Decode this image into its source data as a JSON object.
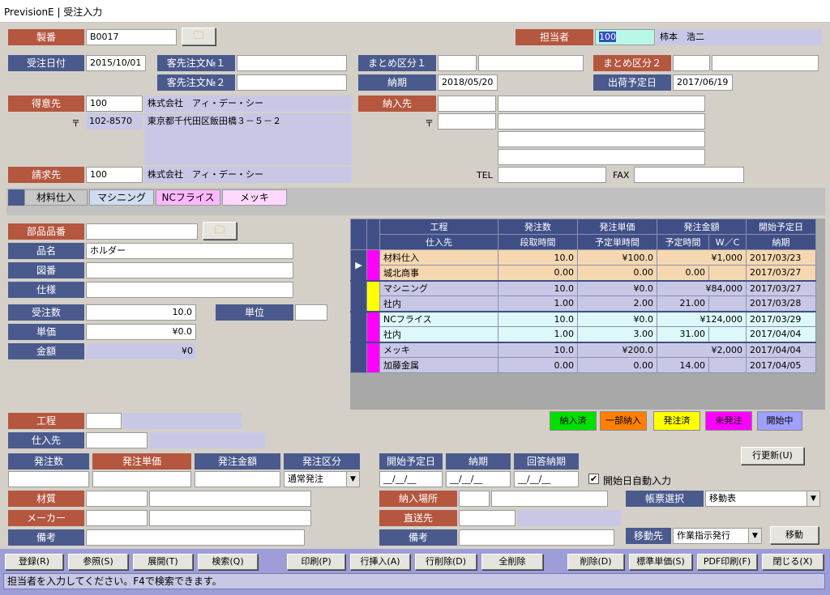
{
  "window": {
    "title": "PrevisionE | 受注入力"
  },
  "header": {
    "seiban_label": "製番",
    "seiban_value": "B0017",
    "tantou_label": "担当者",
    "tantou_code": "100",
    "tantou_name": "柿本　浩二",
    "juchubi_label": "受注日付",
    "juchubi_value": "2015/10/01",
    "kyakusaki1_label": "客先注文№１",
    "kyakusaki1_value": "",
    "kyakusaki2_label": "客先注文№２",
    "kyakusaki2_value": "",
    "matome1_label": "まとめ区分１",
    "matome1_a": "",
    "matome1_b": "",
    "matome2_label": "まとめ区分２",
    "matome2_a": "",
    "matome2_b": "",
    "nouki_label": "納期",
    "nouki_value": "2018/05/20",
    "shukka_label": "出荷予定日",
    "shukka_value": "2017/06/19",
    "tokuisaki_label": "得意先",
    "tokuisaki_code": "100",
    "tokuisaki_name": "株式会社　アィ・デー・シー",
    "zip_mark": "〒",
    "zip_value": "102-8570",
    "address": "東京都千代田区飯田橋３－５－２",
    "seikyusaki_label": "請求先",
    "seikyusaki_code": "100",
    "seikyusaki_name": "株式会社　アィ・デー・シー",
    "nounyusaki_label": "納入先",
    "nounyusaki_zip_mark": "〒",
    "tel_label": "TEL",
    "fax_label": "FAX"
  },
  "tabs": [
    {
      "label": "材料仕入",
      "color": "#c8c8c8"
    },
    {
      "label": "マシニング",
      "color": "#d0dcf0"
    },
    {
      "label": "NCフライス",
      "color": "#ffb8ff"
    },
    {
      "label": "メッキ",
      "color": "#ffd8ff"
    }
  ],
  "part": {
    "buhin_label": "部品品番",
    "buhin_value": "",
    "hinmei_label": "品名",
    "hinmei_value": "ホルダー",
    "zuban_label": "図番",
    "zuban_value": "",
    "shiyou_label": "仕様",
    "shiyou_value": "",
    "juchusu_label": "受注数",
    "juchusu_value": "10.0",
    "tani_label": "単位",
    "tani_value": "",
    "tanka_label": "単価",
    "tanka_value": "¥0.0",
    "kingaku_label": "金額",
    "kingaku_value": "¥0"
  },
  "grid": {
    "header1": [
      "工程",
      "発注数",
      "発注単価",
      "発注金額",
      "開始予定日"
    ],
    "header2": [
      "仕入先",
      "段取時間",
      "予定単時間",
      "予定時間",
      "W／C",
      "納期"
    ],
    "rows": [
      {
        "color": "#ff00ff",
        "bg": "#f5d8b0",
        "selected": true,
        "koutei": "材料仕入",
        "hatchusu": "10.0",
        "tanka": "¥100.0",
        "kingaku": "¥1,000",
        "kaishi": "2017/03/23",
        "shiire": "城北商事",
        "dandori": "0.00",
        "tanjikan": "0.00",
        "yotei": "0.00",
        "wc": "",
        "nouki": "2017/03/27"
      },
      {
        "color": "#ffff00",
        "bg": "#c8c8e6",
        "selected": false,
        "koutei": "マシニング",
        "hatchusu": "10.0",
        "tanka": "¥0.0",
        "kingaku": "¥84,000",
        "kaishi": "2017/03/27",
        "shiire": "社内",
        "dandori": "1.00",
        "tanjikan": "2.00",
        "yotei": "21.00",
        "wc": "",
        "nouki": "2017/03/28"
      },
      {
        "color": "#ff00ff",
        "bg": "#dcf8f8",
        "selected": false,
        "koutei": "NCフライス",
        "hatchusu": "10.0",
        "tanka": "¥0.0",
        "kingaku": "¥124,000",
        "kaishi": "2017/03/29",
        "shiire": "社内",
        "dandori": "1.00",
        "tanjikan": "3.00",
        "yotei": "31.00",
        "wc": "",
        "nouki": "2017/04/04"
      },
      {
        "color": "#ff00ff",
        "bg": "#c8c8e6",
        "selected": false,
        "koutei": "メッキ",
        "hatchusu": "10.0",
        "tanka": "¥200.0",
        "kingaku": "¥2,000",
        "kaishi": "2017/04/04",
        "shiire": "加藤金属",
        "dandori": "0.00",
        "tanjikan": "0.00",
        "yotei": "14.00",
        "wc": "",
        "nouki": "2017/04/05"
      }
    ]
  },
  "legend": [
    {
      "label": "納入済",
      "color": "#00e000"
    },
    {
      "label": "一部納入",
      "color": "#ff8000"
    },
    {
      "label": "発注済",
      "color": "#ffff00"
    },
    {
      "label": "未発注",
      "color": "#ff00ff"
    },
    {
      "label": "開始中",
      "color": "#a0a0ff"
    }
  ],
  "detail": {
    "koutei_label": "工程",
    "shiiresaki_label": "仕入先",
    "hatchusu_label": "発注数",
    "hatchutanka_label": "発注単価",
    "hatchukingaku_label": "発注金額",
    "hatchukubun_label": "発注区分",
    "hatchukubun_value": "通常発注",
    "kaishi_label": "開始予定日",
    "nouki_label": "納期",
    "kaitou_label": "回答納期",
    "date_placeholder": "__/__/__",
    "auto_start_label": "開始日自動入力",
    "auto_start_checked": "✔",
    "gyou_koushin": "行更新(U)",
    "zaishitsu_label": "材質",
    "maker_label": "メーカー",
    "bikou_label": "備考",
    "nounyu_basho_label": "納入場所",
    "chokusou_label": "直送先",
    "bikou2_label": "備考",
    "chouhyou_label": "帳票選択",
    "chouhyou_value": "移動表",
    "idousaki_label": "移動先",
    "idousaki_value": "作業指示発行",
    "idou_button": "移動"
  },
  "footer": {
    "buttons": [
      "登録(R)",
      "参照(S)",
      "展開(T)",
      "検索(Q)",
      "印刷(P)",
      "行挿入(A)",
      "行削除(D)",
      "全削除",
      "削除(D)",
      "標準単価(S)",
      "PDF印刷(F)",
      "閉じる(X)"
    ],
    "status": "担当者を入力してください。F4で検索できます。"
  }
}
